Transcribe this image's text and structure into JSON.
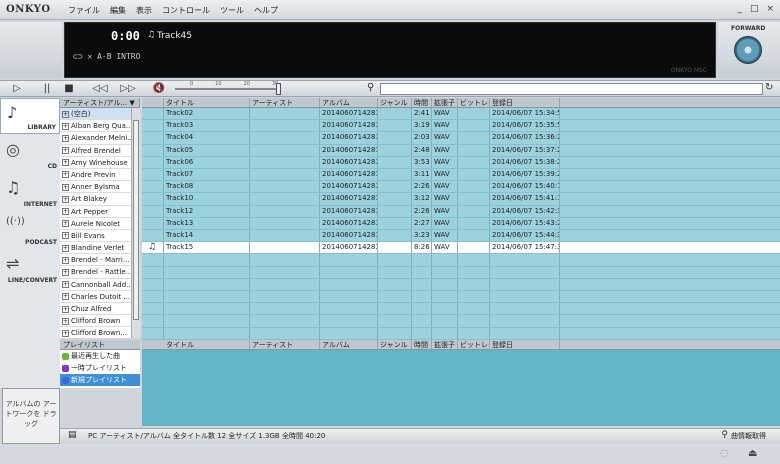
{
  "app": {
    "logo": "ONKYO",
    "menu": [
      "ファイル",
      "編集",
      "表示",
      "コントロール",
      "ツール",
      "ヘルプ"
    ],
    "window_controls": [
      "_",
      "□",
      "×"
    ]
  },
  "display": {
    "time": "0:00",
    "note_icon": "♫",
    "track": "Track45",
    "modes": "⊂⊃  ✕  A-B  INTRO",
    "brand": "ONKYO MSC"
  },
  "forward": {
    "label": "FORWARD"
  },
  "transport": {
    "play": "▷",
    "pause": "||",
    "stop": "■",
    "prev": "◁◁",
    "next": "▷▷",
    "mute": "🔇",
    "vol_scale": [
      "0",
      "10",
      "20",
      "30"
    ],
    "search_placeholder": ""
  },
  "categories": [
    {
      "label": "LIBRARY",
      "icon": "♪"
    },
    {
      "label": "CD",
      "icon": "◎"
    },
    {
      "label": "INTERNET",
      "icon": "♫"
    },
    {
      "label": "PODCAST",
      "icon": "((·))"
    },
    {
      "label": "LINE/CONVERT",
      "icon": "⇌"
    }
  ],
  "artwork_hint": "アルバムの アートワークを ドラッグ",
  "artists": {
    "header": "アーティスト/アル... ▼",
    "items": [
      "(空白)",
      "Alban Berg Qua...",
      "Alexander Melni...",
      "Alfred Brendel",
      "Amy Winehouse",
      "Andre Previn",
      "Anner Bylsma",
      "Art Blakey",
      "Art Pepper",
      "Aurele Nicolet",
      "Bill Evans",
      "Blandine Verlet",
      "Brendel - Marri...",
      "Brendel - Rattle...",
      "Cannonball Add...",
      "Charles Dutoit ...",
      "Chuz Alfred",
      "Clifford Brown",
      "Clifford Brown..."
    ]
  },
  "grid": {
    "columns": [
      "",
      "タイトル",
      "アーティスト",
      "アルバム",
      "ジャンル",
      "時間",
      "拡張子",
      "ビットレー...",
      "登録日"
    ],
    "rows": [
      {
        "title": "Track02",
        "album": "20140607142832",
        "time": "2:41",
        "ext": "WAV",
        "date": "2014/06/07 15:34:54"
      },
      {
        "title": "Track03",
        "album": "20140607142832",
        "time": "3:19",
        "ext": "WAV",
        "date": "2014/06/07 15:35:51"
      },
      {
        "title": "Track04",
        "album": "20140607142832",
        "time": "2:03",
        "ext": "WAV",
        "date": "2014/06/07 15:36:27"
      },
      {
        "title": "Track05",
        "album": "20140607142832",
        "time": "2:48",
        "ext": "WAV",
        "date": "2014/06/07 15:37:20"
      },
      {
        "title": "Track06",
        "album": "20140607142832",
        "time": "3:53",
        "ext": "WAV",
        "date": "2014/06/07 15:38:29"
      },
      {
        "title": "Track07",
        "album": "20140607142832",
        "time": "3:11",
        "ext": "WAV",
        "date": "2014/06/07 15:39:27"
      },
      {
        "title": "Track08",
        "album": "20140607142832",
        "time": "2:26",
        "ext": "WAV",
        "date": "2014/06/07 15:40:11"
      },
      {
        "title": "Track10",
        "album": "20140607142832",
        "time": "3:12",
        "ext": "WAV",
        "date": "2014/06/07 15:41:11"
      },
      {
        "title": "Track12",
        "album": "20140607142832",
        "time": "2:26",
        "ext": "WAV",
        "date": "2014/06/07 15:42:39"
      },
      {
        "title": "Track13",
        "album": "20140607142832",
        "time": "2:27",
        "ext": "WAV",
        "date": "2014/06/07 15:43:26"
      },
      {
        "title": "Track14",
        "album": "20140607142832",
        "time": "3:23",
        "ext": "WAV",
        "date": "2014/06/07 15:44:34"
      },
      {
        "title": "Track15",
        "album": "20140607142832",
        "time": "8:26",
        "ext": "WAV",
        "date": "2014/06/07 15:47:32",
        "playing": true
      }
    ]
  },
  "playlists": {
    "header": "プレイリスト",
    "items": [
      "最近再生した曲",
      "一時プレイリスト",
      "新規プレイリスト"
    ],
    "selected": 2,
    "columns": [
      "タイトル",
      "アーティスト",
      "アルバム",
      "ジャンル",
      "時間",
      "拡張子",
      "ビットレー...",
      "登録日"
    ]
  },
  "status": {
    "text": "PC アーティスト/アルバム  全タイトル数 12  全サイズ 1.3GB  全時間 40:20",
    "info": "曲情報取得"
  },
  "colors": {
    "grid_bg": "#8ccbd8",
    "row_bg": "#9cd2de",
    "selected_playlist": "#3e8fd6"
  }
}
